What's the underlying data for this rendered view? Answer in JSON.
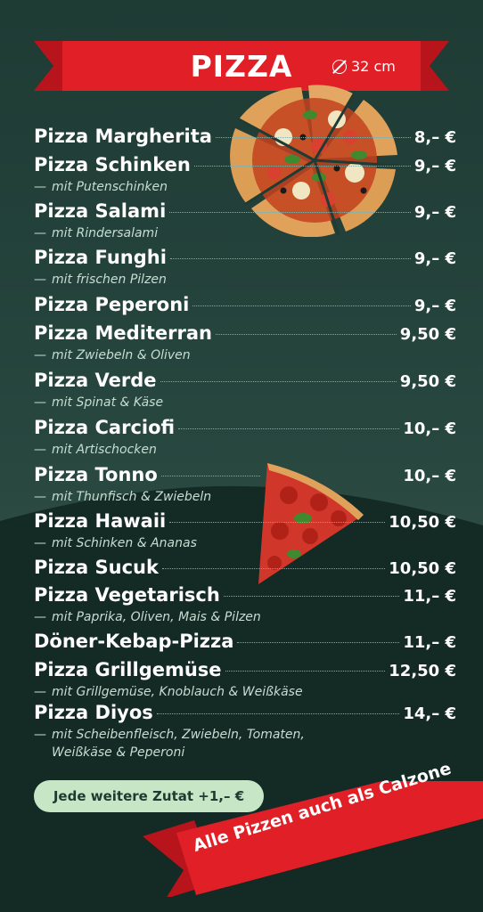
{
  "header": {
    "title": "PIZZA",
    "size": "32 cm"
  },
  "items": [
    {
      "name": "Pizza Margherita",
      "price": "8,– €",
      "desc": ""
    },
    {
      "name": "Pizza Schinken",
      "price": "9,– €",
      "desc": "mit Putenschinken"
    },
    {
      "name": "Pizza Salami",
      "price": "9,– €",
      "desc": "mit Rindersalami"
    },
    {
      "name": "Pizza Funghi",
      "price": "9,– €",
      "desc": "mit frischen Pilzen"
    },
    {
      "name": "Pizza Peperoni",
      "price": "9,– €",
      "desc": ""
    },
    {
      "name": "Pizza Mediterran",
      "price": "9,50 €",
      "desc": "mit Zwiebeln & Oliven"
    },
    {
      "name": "Pizza Verde",
      "price": "9,50 €",
      "desc": "mit Spinat & Käse"
    },
    {
      "name": "Pizza Carciofi",
      "price": "10,– €",
      "desc": "mit Artischocken"
    },
    {
      "name": "Pizza Tonno",
      "price": "10,– €",
      "desc": "mit Thunfisch & Zwiebeln"
    },
    {
      "name": "Pizza Hawaii",
      "price": "10,50 €",
      "desc": "mit Schinken & Ananas"
    },
    {
      "name": "Pizza Sucuk",
      "price": "10,50 €",
      "desc": ""
    },
    {
      "name": "Pizza Vegetarisch",
      "price": "11,– €",
      "desc": "mit Paprika, Oliven, Mais & Pilzen"
    },
    {
      "name": "Döner-Kebap-Pizza",
      "price": "11,– €",
      "desc": ""
    },
    {
      "name": "Pizza Grillgemüse",
      "price": "12,50 €",
      "desc": "mit Grillgemüse, Knoblauch & Weißkäse"
    },
    {
      "name": "Pizza Diyos",
      "price": "14,– €",
      "desc": "mit Scheibenfleisch, Zwiebeln, Tomaten, Weißkäse & Peperoni"
    }
  ],
  "extra_topping": "Jede weitere Zutat +1,– €",
  "calzone_note": "Alle Pizzen auch als Calzone",
  "colors": {
    "red": "#e01f26",
    "dark_green": "#1e3b34",
    "mint": "#c7e6c6"
  },
  "icons": [
    "diameter-icon"
  ]
}
